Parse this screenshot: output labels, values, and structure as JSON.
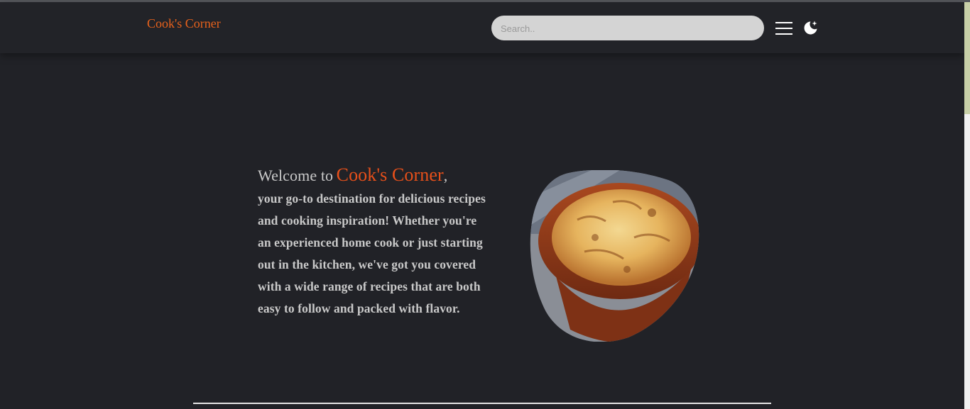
{
  "header": {
    "logo": "Cook's Corner",
    "search_placeholder": "Search..",
    "menu_icon": "hamburger-menu-icon",
    "theme_icon": "moon-star-icon"
  },
  "hero": {
    "welcome": "Welcome to",
    "brand": "Cook's Corner",
    "comma": ",",
    "body": "your go-to destination for delicious recipes and cooking inspiration! Whether you're an experienced home cook or just starting out in the kitchen, we've got you covered with a wide range of recipes that are both easy to follow and packed with flavor.",
    "image": "potato-gratin-dish-image"
  },
  "colors": {
    "background": "#212227",
    "accent": "#e8501a",
    "text": "#c9c9c9"
  }
}
